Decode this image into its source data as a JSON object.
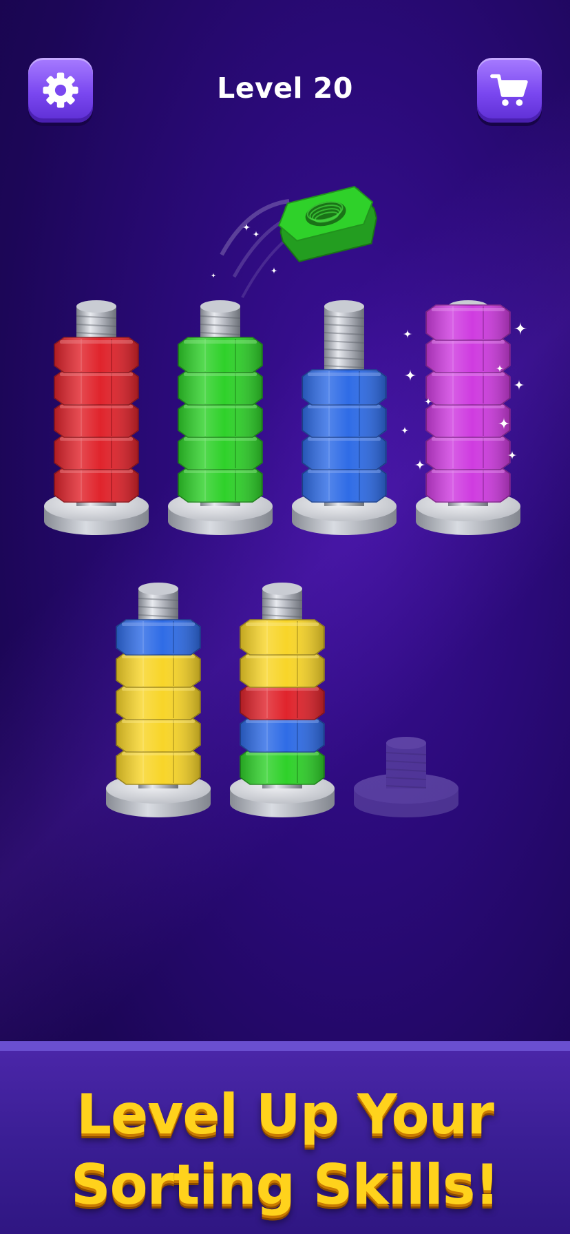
{
  "header": {
    "level_label": "Level 20",
    "settings_icon": "gear-icon",
    "shop_icon": "cart-icon"
  },
  "board": {
    "rows": [
      [
        {
          "nuts": [
            "red",
            "red",
            "red",
            "red",
            "red"
          ],
          "state": "full"
        },
        {
          "nuts": [
            "green",
            "green",
            "green",
            "green",
            "green"
          ],
          "state": "full"
        },
        {
          "nuts": [
            "blue",
            "blue",
            "blue",
            "blue"
          ],
          "state": "partial"
        },
        {
          "nuts": [
            "magenta",
            "magenta",
            "magenta",
            "magenta",
            "magenta",
            "magenta"
          ],
          "state": "complete",
          "sparkles": true
        }
      ],
      [
        {
          "nuts": [
            "yellow",
            "yellow",
            "yellow",
            "yellow",
            "blue"
          ],
          "state": "full"
        },
        {
          "nuts": [
            "green",
            "blue",
            "red",
            "yellow",
            "yellow"
          ],
          "state": "full"
        },
        {
          "nuts": [],
          "state": "empty"
        }
      ]
    ],
    "moving_nut": {
      "color": "green"
    }
  },
  "colors": {
    "red": "#e0242c",
    "green": "#2fd12a",
    "blue": "#2f6ce6",
    "yellow": "#f8d529",
    "magenta": "#cf3ce0",
    "accent_yellow": "#ffd21c",
    "button_purple": "#7a47f0"
  },
  "banner": {
    "line1": "Level Up Your",
    "line2": "Sorting Skills!"
  }
}
